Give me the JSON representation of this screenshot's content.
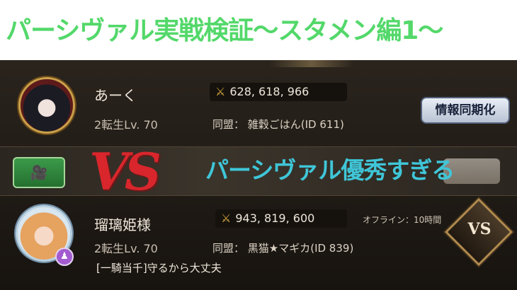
{
  "banner": {
    "title": "パーシヴァル実戦検証〜スタメン編1〜"
  },
  "player1": {
    "name": "あーく",
    "power": "628, 618, 966",
    "level": "2転生Lv. 70",
    "alliance": "同盟： 雑穀ごはん(ID 611)",
    "sync_button": "情報同期化"
  },
  "overlay": {
    "vs_text": "VS",
    "caption": "パーシヴァル優秀すぎる"
  },
  "player2": {
    "name": "瑠璃姫様",
    "power": "943, 819, 600",
    "status": "オフライン：10時間",
    "level": "2転生Lv. 70",
    "alliance": "同盟： 黒猫★マギカ(ID 839)",
    "quote": "[一騎当千]守るから大丈夫",
    "vs_button": "VS"
  },
  "colors": {
    "banner_title": "#53d86a",
    "caption": "#3fc6d8",
    "vs_overlay": "#d8262c",
    "power_icon": "#d7a93c"
  },
  "icons": {
    "power": "crossed-swords-icon",
    "video": "video-camera-icon",
    "badge": "person-badge-icon"
  }
}
